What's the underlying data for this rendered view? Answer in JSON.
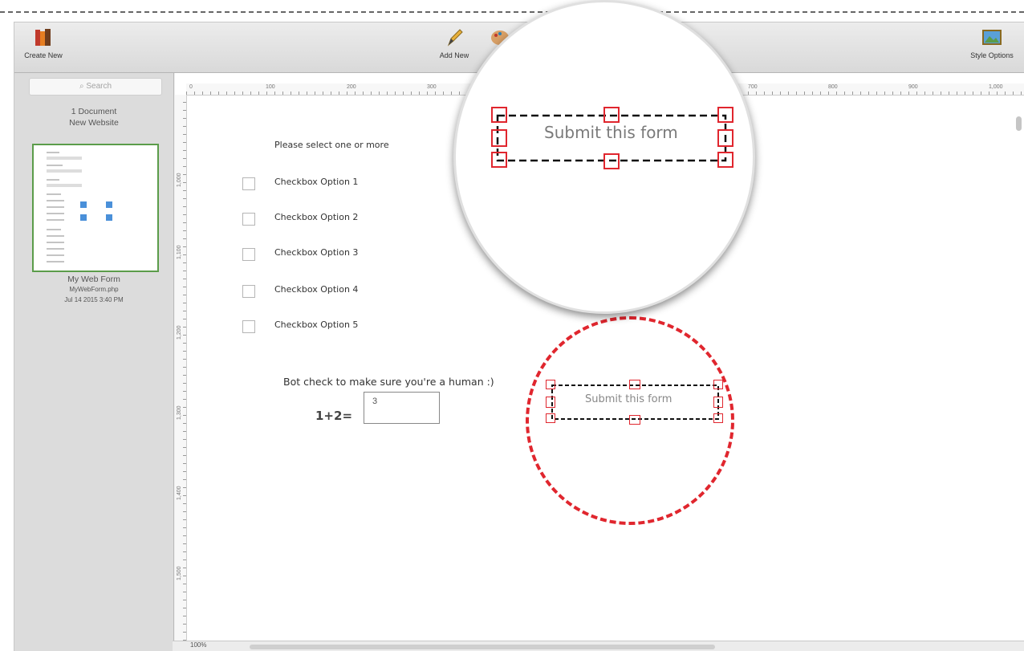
{
  "toolbar": {
    "create_new_label": "Create New",
    "add_new_label": "Add New",
    "style_options_label": "Style Options"
  },
  "sidebar": {
    "search_placeholder": "Search",
    "doc_count": "1 Document",
    "site_name": "New Website",
    "thumbnail": {
      "title": "My Web Form",
      "filename": "MyWebForm.php",
      "date": "Jul 14 2015 3:40 PM"
    }
  },
  "rulers": {
    "top": [
      "0",
      "100",
      "200",
      "300",
      "700",
      "800",
      "900",
      "1,000"
    ],
    "left": [
      "1,000",
      "1,100",
      "1,200",
      "1,300",
      "1,400",
      "1,500"
    ]
  },
  "form": {
    "checkbox_prompt": "Please select one or more",
    "checkboxes": [
      {
        "label": "Checkbox Option 1",
        "checked": false
      },
      {
        "label": "Checkbox Option 2",
        "checked": false
      },
      {
        "label": "Checkbox Option 3",
        "checked": false
      },
      {
        "label": "Checkbox Option 4",
        "checked": false
      },
      {
        "label": "Checkbox Option 5",
        "checked": false
      }
    ],
    "bot_check_label": "Bot check to make sure you're a human :)",
    "captcha_question": "1+2=",
    "captcha_value": "3",
    "submit_label": "Submit this form"
  },
  "status": {
    "zoom": "100%"
  },
  "colors": {
    "highlight_red": "#e0262e",
    "selection_green": "#5b9c4a",
    "app_icon_blue": "#4a90d9"
  }
}
